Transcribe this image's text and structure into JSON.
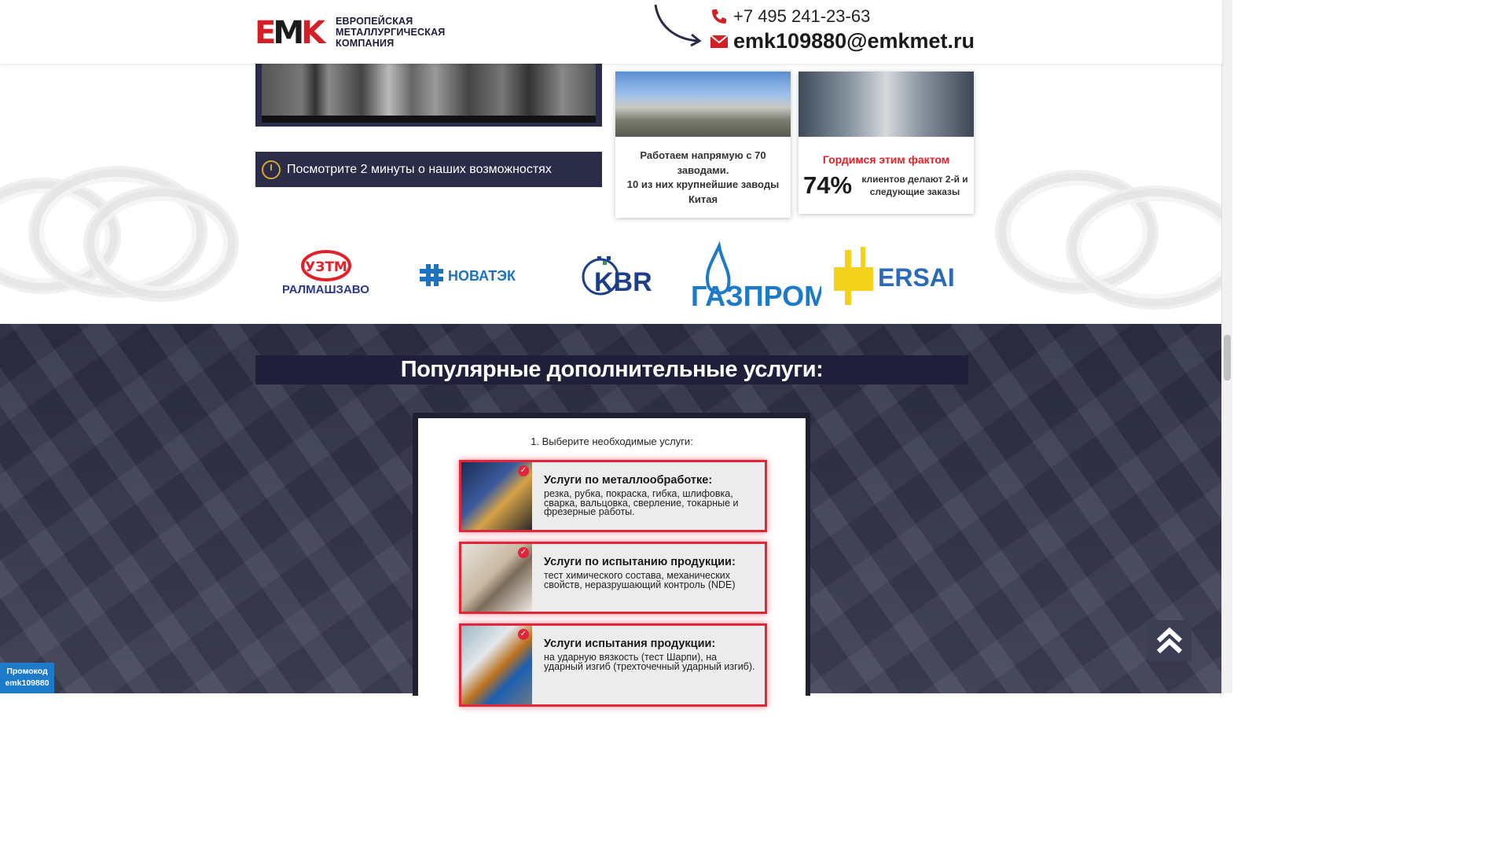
{
  "header": {
    "logo_text_line1": "ЕВРОПЕЙСКАЯ",
    "logo_text_line2": "МЕТАЛЛУРГИЧЕСКАЯ",
    "logo_text_line3": "КОМПАНИЯ",
    "logo_mark": "EMK",
    "phone": "+7 495 241-23-63",
    "email": "emk109880@emkmet.ru"
  },
  "video": {
    "watch_label": "Посмотрите 2 минуты о наших возможностях"
  },
  "cards": {
    "factories_line1": "Работаем напрямую с 70 заводами.",
    "factories_line2": "10 из них крупнейшие заводы Китая",
    "proud_title": "Гордимся этим фактом",
    "percent": "74%",
    "percent_desc": "клиентов делают 2-й и следующие заказы"
  },
  "partners": [
    "УРАЛМАШЗАВОД",
    "НОВАТЭК",
    "KBR",
    "ГАЗПРОМ",
    "ERSAI"
  ],
  "partner_marks": {
    "uzm": "УЗТМ"
  },
  "services": {
    "heading": "Популярные дополнительные услуги:",
    "step_label": "1. Выберите необходимые услуги:",
    "items": [
      {
        "title": "Услуги по металлообработке:",
        "desc": "резка, рубка, покраска, гибка, шлифовка, сварка, вальцовка, сверление, токарные и фрезерные работы."
      },
      {
        "title": "Услуги по испытанию продукции:",
        "desc": "тест химического состава, механических свойств, неразрушающий контроль (NDE)"
      },
      {
        "title": "Услуги испытания продукции:",
        "desc": "на ударную вязкость (тест Шарпи), на ударный изгиб (трехточечный ударный изгиб)."
      }
    ]
  },
  "promo": {
    "label": "Промокод",
    "code": "emk109880"
  },
  "colors": {
    "brand_red": "#d32027",
    "dark_navy": "#2a2c48",
    "accent_blue": "#1d7ac9"
  }
}
